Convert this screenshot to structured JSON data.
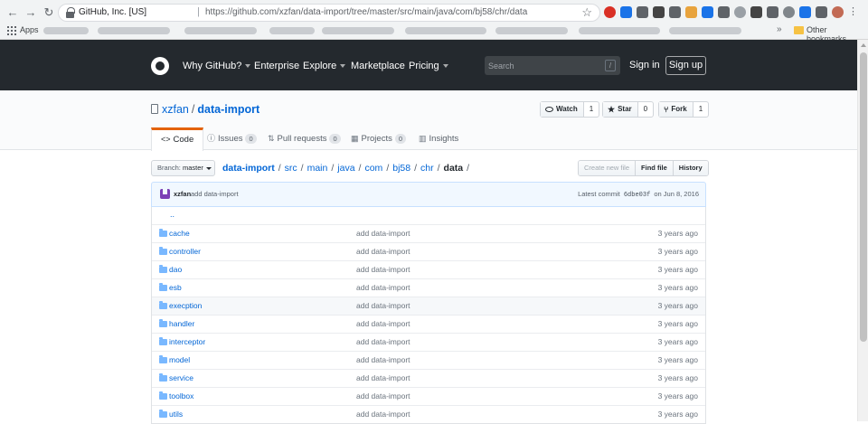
{
  "browser": {
    "site_name": "GitHub, Inc. [US]",
    "url": "https://github.com/xzfan/data-import/tree/master/src/main/java/com/bj58/chr/data",
    "apps_label": "Apps",
    "other_bookmarks": "Other bookmarks",
    "more": "»"
  },
  "header": {
    "why_github": "Why GitHub?",
    "enterprise": "Enterprise",
    "explore": "Explore",
    "marketplace": "Marketplace",
    "pricing": "Pricing",
    "search_placeholder": "Search",
    "slash_key": "/",
    "sign_in": "Sign in",
    "sign_up": "Sign up"
  },
  "repo": {
    "owner": "xzfan",
    "name": "data-import",
    "separator": "/",
    "watch_label": "Watch",
    "watch_count": "1",
    "star_label": "Star",
    "star_count": "0",
    "fork_label": "Fork",
    "fork_count": "1"
  },
  "tabs": [
    {
      "label": "Code"
    },
    {
      "label": "Issues",
      "count": "0"
    },
    {
      "label": "Pull requests",
      "count": "0"
    },
    {
      "label": "Projects",
      "count": "0"
    },
    {
      "label": "Insights"
    }
  ],
  "branch": {
    "prefix": "Branch:",
    "name": "master"
  },
  "breadcrumb": {
    "parts": [
      "data-import",
      "src",
      "main",
      "java",
      "com",
      "bj58",
      "chr"
    ],
    "current": "data",
    "sep": "/",
    "trailing": "/"
  },
  "file_buttons": {
    "create": "Create new file",
    "find": "Find file",
    "history": "History"
  },
  "commit": {
    "author": "xzfan",
    "message": "add data-import",
    "latest_label": "Latest commit",
    "sha": "6dbe03f",
    "date": "on Jun 8, 2016"
  },
  "files": {
    "up": "..",
    "rows": [
      {
        "name": "cache",
        "message": "add data-import",
        "age": "3 years ago"
      },
      {
        "name": "controller",
        "message": "add data-import",
        "age": "3 years ago"
      },
      {
        "name": "dao",
        "message": "add data-import",
        "age": "3 years ago"
      },
      {
        "name": "esb",
        "message": "add data-import",
        "age": "3 years ago"
      },
      {
        "name": "execption",
        "message": "add data-import",
        "age": "3 years ago"
      },
      {
        "name": "handler",
        "message": "add data-import",
        "age": "3 years ago"
      },
      {
        "name": "interceptor",
        "message": "add data-import",
        "age": "3 years ago"
      },
      {
        "name": "model",
        "message": "add data-import",
        "age": "3 years ago"
      },
      {
        "name": "service",
        "message": "add data-import",
        "age": "3 years ago"
      },
      {
        "name": "toolbox",
        "message": "add data-import",
        "age": "3 years ago"
      },
      {
        "name": "utils",
        "message": "add data-import",
        "age": "3 years ago"
      }
    ]
  }
}
